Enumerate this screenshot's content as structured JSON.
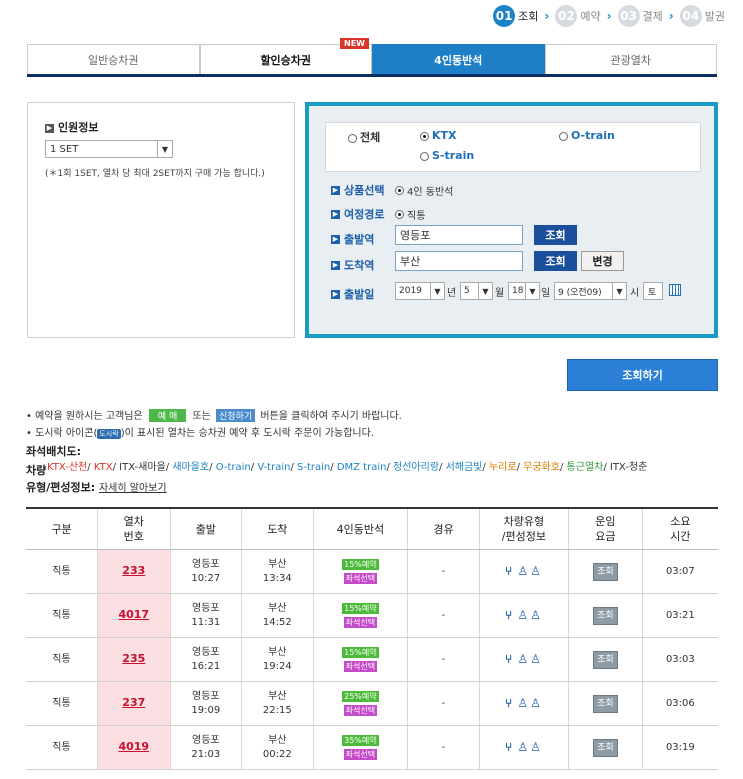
{
  "steps": [
    {
      "num": "01",
      "label": "조회",
      "active": true
    },
    {
      "num": "02",
      "label": "예약",
      "active": false
    },
    {
      "num": "03",
      "label": "결제",
      "active": false
    },
    {
      "num": "04",
      "label": "발권",
      "active": false
    }
  ],
  "tabs": [
    "일반승차권",
    "할인승차권",
    "4인동반석",
    "관광열차"
  ],
  "tab_new_badge": "NEW",
  "passenger": {
    "title": "인원정보",
    "set_value": "1 SET",
    "note": "(＊1회 1SET, 열차 당 최대 2SET까지 구매 가능 합니다.)"
  },
  "train_types": [
    "전체",
    "KTX",
    "O-train",
    "S-train"
  ],
  "form": {
    "product_label": "상품선택",
    "product_value": "4인 동반석",
    "route_label": "여정경로",
    "route_value": "직통",
    "departure_label": "출발역",
    "departure_value": "영등포",
    "arrival_label": "도착역",
    "arrival_value": "부산",
    "search_label": "조회",
    "change_label": "변경",
    "date_label": "출발일",
    "year": "2019",
    "year_unit": "년",
    "month": "5",
    "month_unit": "월",
    "day": "18",
    "day_unit": "일",
    "hour": "9 (오전09)",
    "hour_unit": "시",
    "weekday": "토"
  },
  "search_button": "조회하기",
  "notes": {
    "line1_pre": "예약을 원하시는 고객님은",
    "line1_btn1": "예 매",
    "line1_mid": "또는",
    "line1_btn2": "신청하기",
    "line1_post": "버튼을 클릭하여 주시기 바랍니다.",
    "line2_pre": "도시락 아이콘(",
    "line2_icon": "도시락",
    "line2_post": ")이 표시된 열차는 승차권 예약 후 도시락 주문이 가능합니다."
  },
  "seat_layout_label": "좌석배치도:",
  "vehicle_label": "차량",
  "vehicles": [
    {
      "name": "KTX-산천",
      "color": "#d9352b"
    },
    {
      "name": "KTX",
      "color": "#d9352b"
    },
    {
      "name": "ITX-새마을",
      "color": "#333333"
    },
    {
      "name": "새마을호",
      "color": "#1d83c6"
    },
    {
      "name": "O-train",
      "color": "#1d83c6"
    },
    {
      "name": "V-train",
      "color": "#1d83c6"
    },
    {
      "name": "S-train",
      "color": "#1d83c6"
    },
    {
      "name": "DMZ train",
      "color": "#1d83c6"
    },
    {
      "name": "정선아리랑",
      "color": "#1d83c6"
    },
    {
      "name": "서해금빛",
      "color": "#1d83c6"
    },
    {
      "name": "누리로",
      "color": "#e07b00"
    },
    {
      "name": "무궁화호",
      "color": "#e07b00"
    },
    {
      "name": "통근열차",
      "color": "#2e9a3a"
    },
    {
      "name": "ITX-청춘",
      "color": "#333333"
    }
  ],
  "type_info_label": "유형/편성정보:",
  "type_info_link": "자세히 알아보기",
  "table": {
    "headers": [
      "구분",
      "열차\n번호",
      "출발",
      "도착",
      "4인동반석",
      "경유",
      "차량유형\n/편성정보",
      "운임\n요금",
      "소요\n시간"
    ],
    "rows": [
      {
        "type": "직통",
        "train_no": "233",
        "dep_station": "영등포",
        "dep_time": "10:27",
        "arr_station": "부산",
        "arr_time": "13:34",
        "discount": "15%예약",
        "seat": "좌석선택",
        "via": "-",
        "fare": "조회",
        "duration": "03:07"
      },
      {
        "type": "직통",
        "train_no": "4017",
        "dep_station": "영등포",
        "dep_time": "11:31",
        "arr_station": "부산",
        "arr_time": "14:52",
        "discount": "15%예약",
        "seat": "좌석선택",
        "via": "-",
        "fare": "조회",
        "duration": "03:21"
      },
      {
        "type": "직통",
        "train_no": "235",
        "dep_station": "영등포",
        "dep_time": "16:21",
        "arr_station": "부산",
        "arr_time": "19:24",
        "discount": "15%예약",
        "seat": "좌석선택",
        "via": "-",
        "fare": "조회",
        "duration": "03:03"
      },
      {
        "type": "직통",
        "train_no": "237",
        "dep_station": "영등포",
        "dep_time": "19:09",
        "arr_station": "부산",
        "arr_time": "22:15",
        "discount": "25%예약",
        "seat": "좌석선택",
        "via": "-",
        "fare": "조회",
        "duration": "03:06"
      },
      {
        "type": "직통",
        "train_no": "4019",
        "dep_station": "영등포",
        "dep_time": "21:03",
        "arr_station": "부산",
        "arr_time": "00:22",
        "discount": "35%예약",
        "seat": "좌석선택",
        "via": "-",
        "fare": "조회",
        "duration": "03:19"
      }
    ]
  },
  "colors": {
    "accent": "#1f7fc6",
    "navy": "#0b2f62",
    "teal_border": "#1a9bc4",
    "train_no": "#c8102e"
  }
}
